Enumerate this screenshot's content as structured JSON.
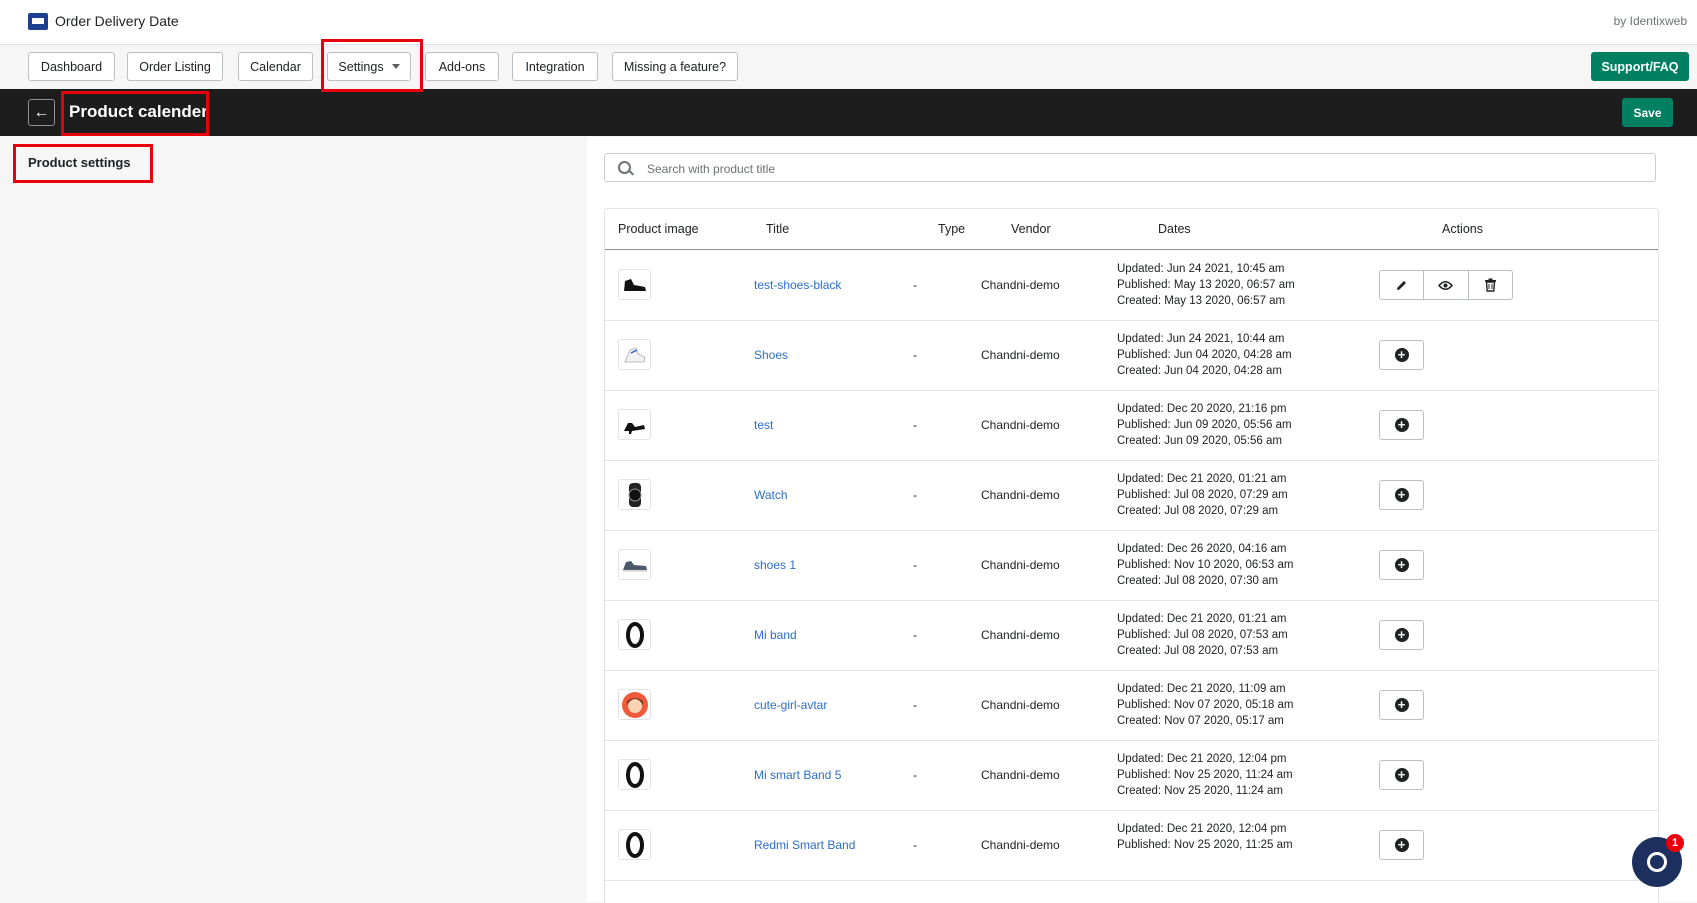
{
  "app": {
    "title": "Order Delivery Date",
    "by": "by Identixweb"
  },
  "nav": {
    "dashboard": "Dashboard",
    "order_listing": "Order Listing",
    "calendar": "Calendar",
    "settings": "Settings",
    "addons": "Add-ons",
    "integration": "Integration",
    "missing": "Missing a feature?",
    "support": "Support/FAQ"
  },
  "titlebar": {
    "back": "←",
    "title": "Product calender",
    "save": "Save"
  },
  "left": {
    "heading": "Product settings"
  },
  "search": {
    "placeholder": "Search with product title"
  },
  "table": {
    "headers": [
      "Product image",
      "Title",
      "Type",
      "Vendor",
      "Dates",
      "Actions"
    ],
    "rows": [
      {
        "image": "black-shoe",
        "title": "test-shoes-black",
        "type": "-",
        "vendor": "Chandni-demo",
        "updated": "Updated: Jun 24 2021, 10:45 am",
        "published": "Published: May 13 2020, 06:57 am",
        "created": "Created: May 13 2020, 06:57 am",
        "actions": "edit-view-delete"
      },
      {
        "image": "white-shoe",
        "title": "Shoes",
        "type": "-",
        "vendor": "Chandni-demo",
        "updated": "Updated: Jun 24 2021, 10:44 am",
        "published": "Published: Jun 04 2020, 04:28 am",
        "created": "Created: Jun 04 2020, 04:28 am",
        "actions": "add"
      },
      {
        "image": "heel-shoe",
        "title": "test",
        "type": "-",
        "vendor": "Chandni-demo",
        "updated": "Updated: Dec 20 2020, 21:16 pm",
        "published": "Published: Jun 09 2020, 05:56 am",
        "created": "Created: Jun 09 2020, 05:56 am",
        "actions": "add"
      },
      {
        "image": "watch",
        "title": "Watch",
        "type": "-",
        "vendor": "Chandni-demo",
        "updated": "Updated: Dec 21 2020, 01:21 am",
        "published": "Published: Jul 08 2020, 07:29 am",
        "created": "Created: Jul 08 2020, 07:29 am",
        "actions": "add"
      },
      {
        "image": "sneaker",
        "title": "shoes 1",
        "type": "-",
        "vendor": "Chandni-demo",
        "updated": "Updated: Dec 26 2020, 04:16 am",
        "published": "Published: Nov 10 2020, 06:53 am",
        "created": "Created: Jul 08 2020, 07:30 am",
        "actions": "add"
      },
      {
        "image": "band",
        "title": "Mi band",
        "type": "-",
        "vendor": "Chandni-demo",
        "updated": "Updated: Dec 21 2020, 01:21 am",
        "published": "Published: Jul 08 2020, 07:53 am",
        "created": "Created: Jul 08 2020, 07:53 am",
        "actions": "add"
      },
      {
        "image": "avatar",
        "title": "cute-girl-avtar",
        "type": "-",
        "vendor": "Chandni-demo",
        "updated": "Updated: Dec 21 2020, 11:09 am",
        "published": "Published: Nov 07 2020, 05:18 am",
        "created": "Created: Nov 07 2020, 05:17 am",
        "actions": "add"
      },
      {
        "image": "band",
        "title": "Mi smart Band 5",
        "type": "-",
        "vendor": "Chandni-demo",
        "updated": "Updated: Dec 21 2020, 12:04 pm",
        "published": "Published: Nov 25 2020, 11:24 am",
        "created": "Created: Nov 25 2020, 11:24 am",
        "actions": "add"
      },
      {
        "image": "band",
        "title": "Redmi Smart Band",
        "type": "-",
        "vendor": "Chandni-demo",
        "updated": "Updated: Dec 21 2020, 12:04 pm",
        "published": "Published: Nov 25 2020, 11:25 am",
        "created": "",
        "actions": "add"
      }
    ]
  },
  "chat": {
    "badge": "1"
  },
  "colors": {
    "primary": "#008060",
    "highlight": "#e8000d",
    "link": "#2c6ecb",
    "titlebar": "#1d1d1d"
  }
}
